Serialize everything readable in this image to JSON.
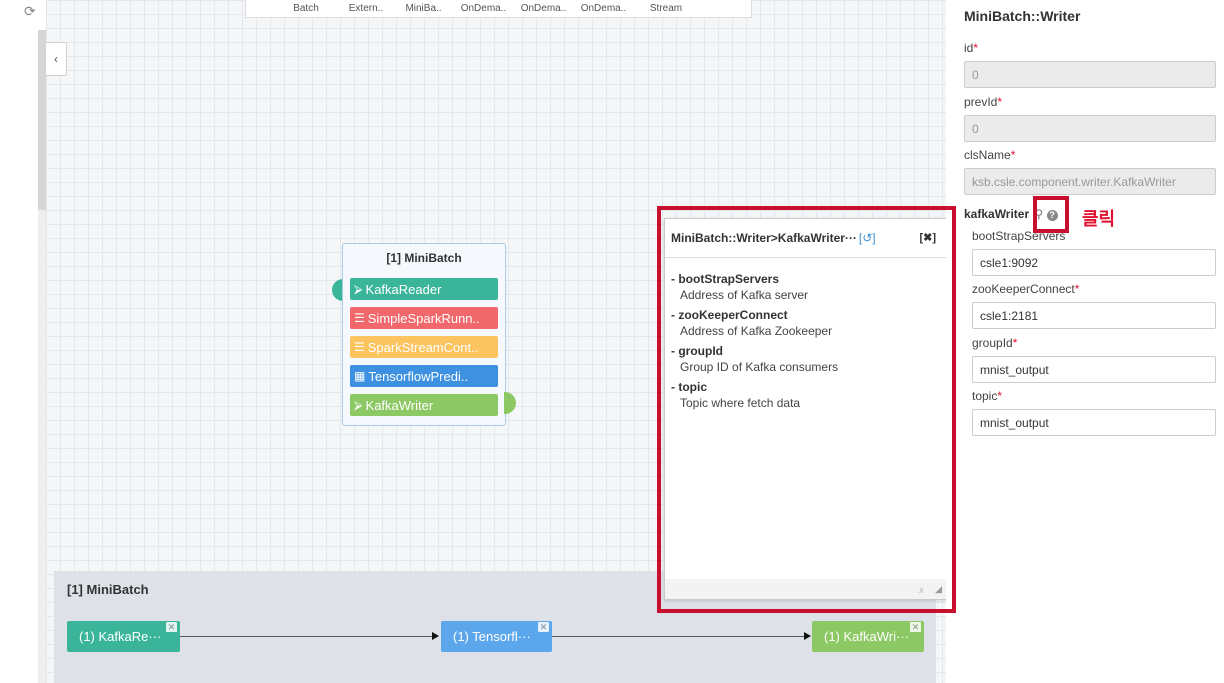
{
  "toolbar": {
    "items": [
      "Batch",
      "Extern..",
      "MiniBa..",
      "OnDema..",
      "OnDema..",
      "OnDema..",
      "Stream"
    ]
  },
  "engine": {
    "title": "[1] MiniBatch",
    "components": [
      {
        "label": "KafkaReader",
        "icon": "reader-icon",
        "color": "#3bb59a"
      },
      {
        "label": "SimpleSparkRunn..",
        "icon": "runner-icon",
        "color": "#f0686b"
      },
      {
        "label": "SparkStreamCont..",
        "icon": "controller-icon",
        "color": "#fcc45e"
      },
      {
        "label": "TensorflowPredi..",
        "icon": "grid-icon",
        "color": "#3d91e0"
      },
      {
        "label": "KafkaWriter",
        "icon": "writer-icon",
        "color": "#8cc864"
      }
    ]
  },
  "pipeline": {
    "title": "[1] MiniBatch",
    "nodes": [
      {
        "label": "(1) KafkaRe···",
        "color": "#3bb59a"
      },
      {
        "label": "(1) Tensorfl···",
        "color": "#5ca7eb"
      },
      {
        "label": "(1) KafkaWri···",
        "color": "#8cc864"
      }
    ]
  },
  "popup": {
    "title": "MiniBatch::Writer>KafkaWriter···",
    "reset_symbol": "[↺]",
    "close_label": "[✖]",
    "entries": [
      {
        "name": "- bootStrapServers",
        "desc": "Address of Kafka server"
      },
      {
        "name": "- zooKeeperConnect",
        "desc": "Address of Kafka Zookeeper"
      },
      {
        "name": "- groupId",
        "desc": "Group ID of Kafka consumers"
      },
      {
        "name": "- topic",
        "desc": "Topic where fetch data"
      }
    ],
    "footer_x": "x"
  },
  "right_panel": {
    "title": "MiniBatch::Writer",
    "fields": [
      {
        "label": "id",
        "value": "0",
        "disabled": true
      },
      {
        "label": "prevId",
        "value": "0",
        "disabled": true
      },
      {
        "label": "clsName",
        "value": "ksb.csle.component.writer.KafkaWriter",
        "disabled": true
      }
    ],
    "section_label": "kafkaWriter",
    "sub_fields": [
      {
        "label": "bootStrapServers",
        "value": "csle1:9092"
      },
      {
        "label": "zooKeeperConnect",
        "value": "csle1:2181"
      },
      {
        "label": "groupId",
        "value": "mnist_output"
      },
      {
        "label": "topic",
        "value": "mnist_output"
      }
    ]
  },
  "annotation": {
    "note": "클릭",
    "color": "#e0102e"
  }
}
